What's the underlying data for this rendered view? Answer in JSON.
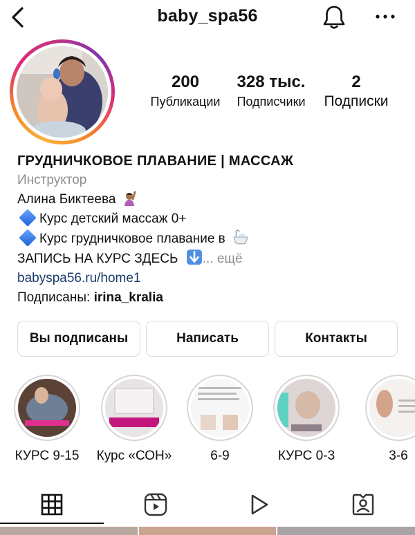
{
  "header": {
    "username": "baby_spa56"
  },
  "stats": {
    "posts": {
      "value": "200",
      "label": "Публикации"
    },
    "followers": {
      "value": "328 тыс.",
      "label": "Подписчики"
    },
    "following": {
      "value": "2",
      "label": "Подписки"
    }
  },
  "bio": {
    "name": "ГРУДНИЧКОВОЕ ПЛАВАНИЕ | МАССАЖ",
    "category": "Инструктор",
    "line1": "Алина Биктеева",
    "line2": "Курс детский массаж 0+",
    "line3": "Курс грудничковое плавание в",
    "line4": "ЗАПИСЬ НА КУРС ЗДЕСЬ",
    "more": "... ещё",
    "link": "babyspa56.ru/home1",
    "followed_by_prefix": "Подписаны: ",
    "followed_by_user": "irina_kralia"
  },
  "actions": {
    "following": "Вы подписаны",
    "message": "Написать",
    "contacts": "Контакты"
  },
  "highlights": [
    {
      "caption": "КУРС 9-15"
    },
    {
      "caption": "Курс «СОН»"
    },
    {
      "caption": "6-9"
    },
    {
      "caption": "КУРС 0-3"
    },
    {
      "caption": "3-6"
    }
  ],
  "tabs": [
    "grid-icon",
    "reels-icon",
    "video-icon",
    "tagged-icon"
  ],
  "colors": {
    "link": "#1a3a69",
    "secondary_text": "#8e8e8e",
    "border": "#dbdbdb",
    "story_ring_gradient": [
      "#fbb03b",
      "#f58529",
      "#dd2a7b",
      "#c13584",
      "#8134af"
    ]
  }
}
